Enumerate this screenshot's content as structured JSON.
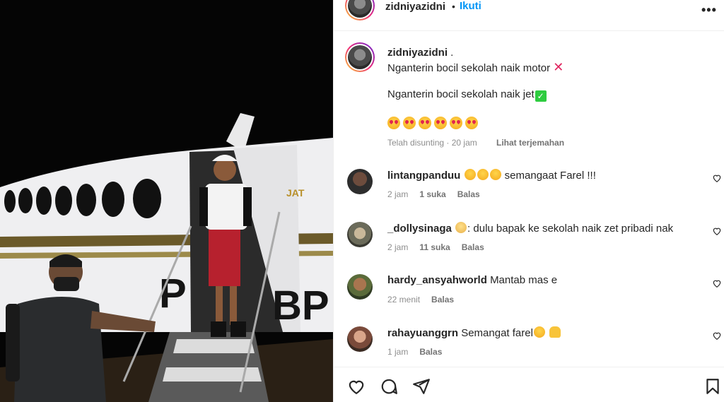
{
  "post": {
    "username": "zidniyazidni",
    "separator": "•",
    "follow_label": "Ikuti",
    "more_label": "•••"
  },
  "caption": {
    "username": "zidniyazidni",
    "suffix": " .",
    "line1": "Nganterin bocil sekolah naik motor",
    "line2": "Nganterin bocil sekolah naik jet",
    "meta": "Telah disunting · 20 jam",
    "translate_label": "Lihat terjemahan"
  },
  "photo": {
    "plane_text_1": "JAT",
    "plane_text_2": "PK-BP"
  },
  "comments": [
    {
      "username": "lintangpanduu",
      "text": " semangaat Farel !!!",
      "time": "2 jam",
      "likes": "1 suka",
      "reply": "Balas"
    },
    {
      "username": "_dollysinaga",
      "text": ": dulu bapak ke sekolah naik zet pribadi nak",
      "time": "2 jam",
      "likes": "11 suka",
      "reply": "Balas"
    },
    {
      "username": "hardy_ansyahworld",
      "text": "Mantab mas e",
      "time": "22 menit",
      "reply": "Balas"
    },
    {
      "username": "rahayuanggrn",
      "text": "Semangat farel",
      "time": "1 jam",
      "reply": "Balas"
    }
  ],
  "colors": {
    "link_blue": "#0095f6",
    "text_primary": "#262626",
    "text_secondary": "#8e8e8e"
  }
}
